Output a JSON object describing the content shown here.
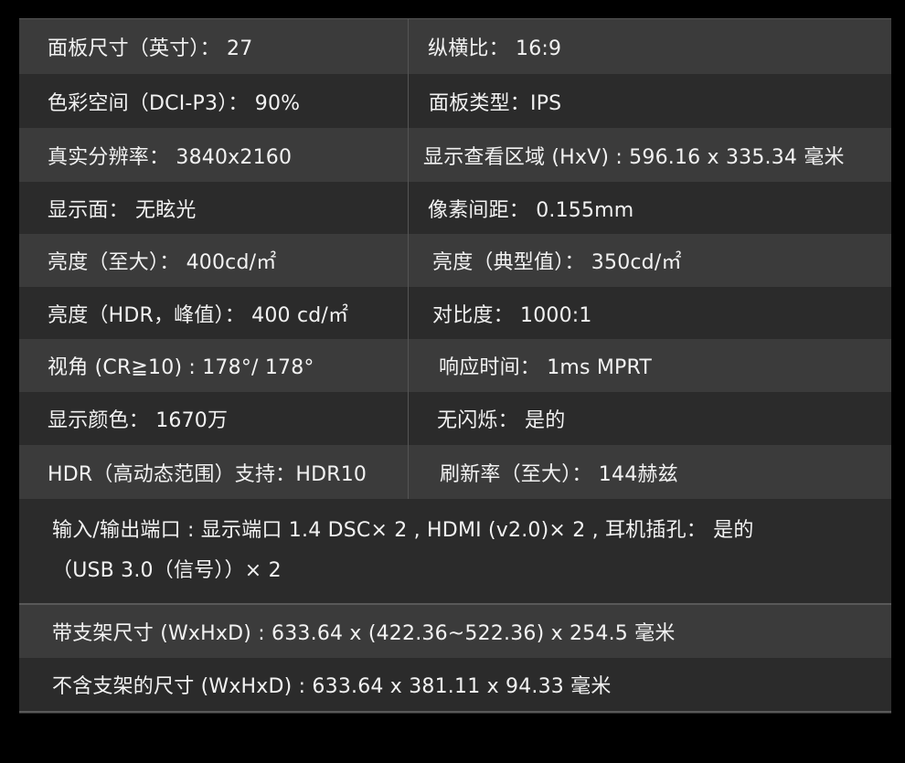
{
  "spec_rows": [
    {
      "left": "面板尺寸（英寸）： 27",
      "right": "纵横比： 16:9"
    },
    {
      "left": "色彩空间（DCI-P3）： 90%",
      "right": "面板类型：IPS"
    },
    {
      "left": "真实分辨率： 3840x2160",
      "right": "显示查看区域 (HxV) : 596.16 x 335.34 毫米"
    },
    {
      "left": "显示面： 无眩光",
      "right": "像素间距： 0.155mm"
    },
    {
      "left": "亮度（至大）： 400cd/㎡",
      "right": "亮度（典型值）： 350cd/㎡"
    },
    {
      "left": "亮度（HDR，峰值）： 400 cd/㎡",
      "right": "对比度： 1000:1"
    },
    {
      "left": "视角 (CR≧10) : 178°/ 178°",
      "right": "响应时间： 1ms MPRT"
    },
    {
      "left": "显示颜色： 1670万",
      "right": "无闪烁： 是的"
    },
    {
      "left": "HDR（高动态范围）支持：HDR10",
      "right": "刷新率（至大）： 144赫兹"
    }
  ],
  "ports": {
    "line1": "输入/输出端口 : 显示端口 1.4 DSC× 2 , HDMI (v2.0)× 2 , 耳机插孔： 是的",
    "line2": "（USB 3.0（信号））× 2"
  },
  "dimensions_with_stand": "带支架尺寸 (WxHxD) : 633.64 x (422.36~522.36) x 254.5 毫米",
  "dimensions_without_stand": "不含支架的尺寸 (WxHxD) : 633.64 x 381.11 x 94.33 毫米",
  "colors": {
    "page_background": "#000000",
    "row_light": "#3b3b3b",
    "row_dark": "#2b2b2b",
    "text": "#f2f2f2",
    "rule": "#595959"
  }
}
